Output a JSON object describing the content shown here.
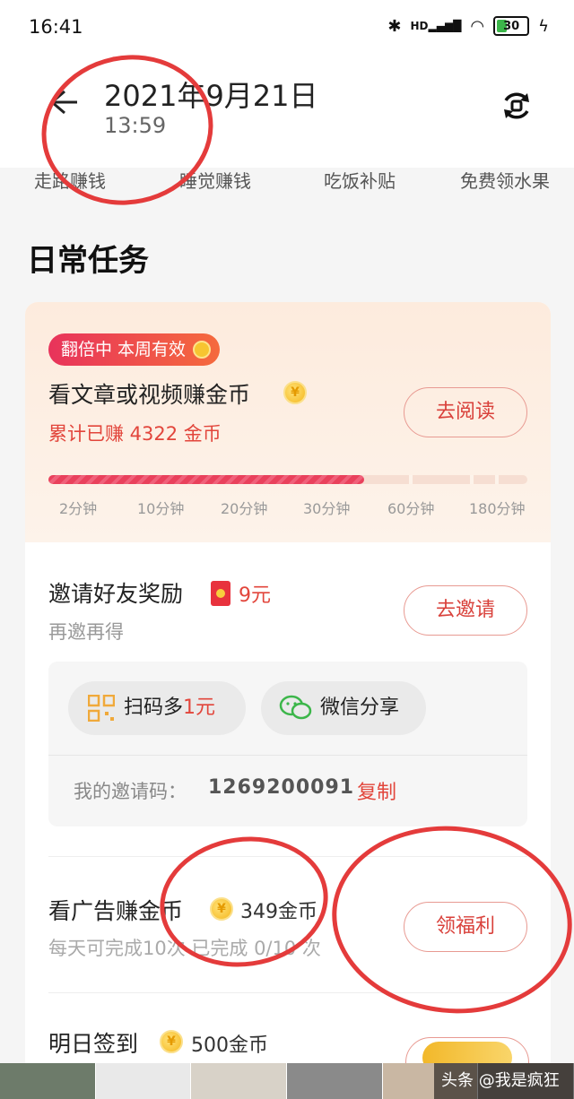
{
  "status_bar": {
    "time": "16:41",
    "network_label": "HD",
    "battery": "30"
  },
  "header": {
    "date": "2021年9月21日",
    "time": "13:59"
  },
  "tabs": [
    "走路赚钱",
    "睡觉赚钱",
    "吃饭补贴",
    "免费领水果"
  ],
  "section_title": "日常任务",
  "task_read": {
    "badge": "翻倍中 本周有效",
    "title": "看文章或视频赚金币",
    "earned": "累计已赚 4322 金币",
    "button": "去阅读",
    "progress_fraction": 0.66,
    "progress_labels": [
      "2分钟",
      "10分钟",
      "20分钟",
      "30分钟",
      "60分钟",
      "180分钟"
    ]
  },
  "task_invite": {
    "title": "邀请好友奖励",
    "reward": "9元",
    "subtitle": "再邀再得",
    "button": "去邀请",
    "scan_label": "扫码多",
    "scan_accent": "1元",
    "wechat_label": "微信分享",
    "code_label": "我的邀请码：",
    "code": "1269200091",
    "copy_label": "复制"
  },
  "task_ads": {
    "title": "看广告赚金币",
    "reward": "349金币",
    "subtitle": "每天可完成10次 已完成 0/10 次",
    "button": "领福利"
  },
  "task_checkin": {
    "title": "明日签到",
    "reward": "500金币"
  },
  "watermark": "头条 @我是疯狂啊",
  "colors": {
    "accent_red": "#e2453b",
    "annotation_red": "#e43b3b",
    "coin_gold": "#f5b71c"
  }
}
